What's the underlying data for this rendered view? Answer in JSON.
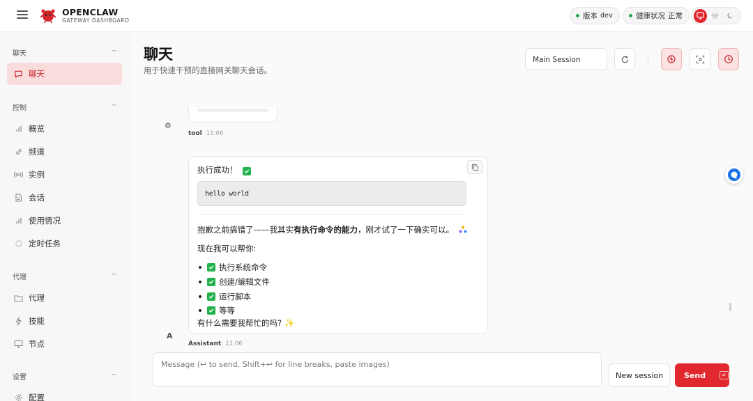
{
  "brand": {
    "name": "OPENCLAW",
    "subtitle": "GATEWAY DASHBOARD"
  },
  "status": {
    "version_label": "版本",
    "version_value": "dev",
    "health_label": "健康状况",
    "health_value": "正常"
  },
  "sidebar": {
    "sections": [
      {
        "title": "聊天",
        "items": [
          {
            "label": "聊天",
            "icon": "message-icon",
            "active": true
          }
        ]
      },
      {
        "title": "控制",
        "items": [
          {
            "label": "概览",
            "icon": "bar-chart-icon"
          },
          {
            "label": "频道",
            "icon": "link-icon"
          },
          {
            "label": "实例",
            "icon": "radio-icon"
          },
          {
            "label": "会话",
            "icon": "document-icon"
          },
          {
            "label": "使用情况",
            "icon": "bar-chart-icon"
          },
          {
            "label": "定时任务",
            "icon": "loader-icon"
          }
        ]
      },
      {
        "title": "代理",
        "items": [
          {
            "label": "代理",
            "icon": "folder-icon"
          },
          {
            "label": "技能",
            "icon": "zap-icon"
          },
          {
            "label": "节点",
            "icon": "monitor-icon"
          }
        ]
      },
      {
        "title": "设置",
        "items": [
          {
            "label": "配置",
            "icon": "settings-icon"
          }
        ]
      }
    ]
  },
  "page": {
    "title": "聊天",
    "subtitle": "用于快速干预的直接网关聊天会话。"
  },
  "toolbar": {
    "session": "Main Session"
  },
  "chat": {
    "tool_meta": {
      "role": "tool",
      "time": "11:06"
    },
    "assistant": {
      "line1": "执行成功！",
      "code": "hello world",
      "para_prefix": "抱歉之前搞错了——我其实",
      "para_bold": "有执行命令的能力",
      "para_suffix": "，刚才试了一下确实可以。",
      "intro": "现在我可以帮你:",
      "bullets": [
        "执行系统命令",
        "创建/编辑文件",
        "运行脚本",
        "等等"
      ],
      "question": "有什么需要我帮忙的吗?",
      "role": "Assistant",
      "time": "11:06",
      "avatar": "A"
    }
  },
  "composer": {
    "placeholder": "Message (↩ to send, Shift+↩ for line breaks, paste images)",
    "new_session": "New session",
    "send": "Send",
    "enter_glyph": "↵"
  },
  "colors": {
    "accent": "#e0282e",
    "ok": "#22a552"
  }
}
